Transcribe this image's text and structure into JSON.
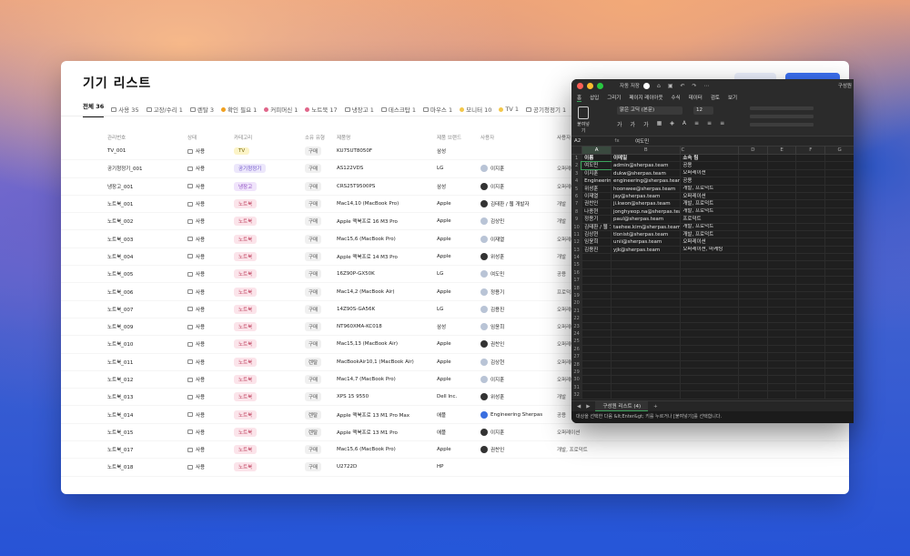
{
  "main": {
    "title": "기기 리스트",
    "tabs": [
      {
        "label": "전체 36",
        "color": ""
      },
      {
        "label": "사용 35",
        "color": ""
      },
      {
        "label": "고장/수리 1",
        "color": ""
      },
      {
        "label": "렌탈 3",
        "color": ""
      },
      {
        "label": "확인 필요 1",
        "color": "#f0a020"
      },
      {
        "label": "커피머신 1",
        "color": "#e0668a"
      },
      {
        "label": "노트북 17",
        "color": "#e0668a"
      },
      {
        "label": "냉장고 1",
        "color": ""
      },
      {
        "label": "데스크탑 1",
        "color": ""
      },
      {
        "label": "마우스 1",
        "color": ""
      },
      {
        "label": "모니터 10",
        "color": "#f3c74a"
      },
      {
        "label": "TV 1",
        "color": "#f3c74a"
      },
      {
        "label": "공기청정기 1",
        "color": ""
      },
      {
        "label": "키보드",
        "color": ""
      }
    ],
    "columns": [
      "관리번호",
      "상태",
      "카테고리",
      "소유 유형",
      "제품명",
      "제품 브랜드",
      "사용자",
      "사용자 소속"
    ],
    "rows": [
      {
        "id": "TV_001",
        "status": "사용",
        "category": "TV",
        "cat_style": "tv",
        "buy": "구매",
        "model": "KU75UT8050F",
        "brand": "삼성",
        "user": "",
        "avatar": "",
        "dept": ""
      },
      {
        "id": "공기청정기_001",
        "status": "사용",
        "category": "공기청정기",
        "cat_style": "ap",
        "buy": "구매",
        "model": "AS122VDS",
        "brand": "LG",
        "user": "이지훈",
        "avatar": "light",
        "dept": "오퍼레이션"
      },
      {
        "id": "냉장고_001",
        "status": "사용",
        "category": "냉장고",
        "cat_style": "fr",
        "buy": "구매",
        "model": "CRS25T9500PS",
        "brand": "삼성",
        "user": "이지훈",
        "avatar": "dark",
        "dept": "오퍼레이션"
      },
      {
        "id": "노트북_001",
        "status": "사용",
        "category": "노트북",
        "cat_style": "nb",
        "buy": "구매",
        "model": "Mac14,10 (MacBook Pro)",
        "brand": "Apple",
        "user": "김태환 / 웹 개발자",
        "avatar": "dark",
        "dept": "개발"
      },
      {
        "id": "노트북_002",
        "status": "사용",
        "category": "노트북",
        "cat_style": "nb",
        "buy": "구매",
        "model": "Apple 맥북프로 16 M3 Pro",
        "brand": "Apple",
        "user": "김상민",
        "avatar": "light",
        "dept": "개발"
      },
      {
        "id": "노트북_003",
        "status": "사용",
        "category": "노트북",
        "cat_style": "nb",
        "buy": "구매",
        "model": "Mac15,6 (MacBook Pro)",
        "brand": "Apple",
        "user": "이재열",
        "avatar": "light",
        "dept": "오퍼레이션"
      },
      {
        "id": "노트북_004",
        "status": "사용",
        "category": "노트북",
        "cat_style": "nb",
        "buy": "구매",
        "model": "Apple 맥북프로 14 M3 Pro",
        "brand": "Apple",
        "user": "위성훈",
        "avatar": "dark",
        "dept": "개발"
      },
      {
        "id": "노트북_005",
        "status": "사용",
        "category": "노트북",
        "cat_style": "nb",
        "buy": "구매",
        "model": "16Z90P-GX50K",
        "brand": "LG",
        "user": "여도민",
        "avatar": "light",
        "dept": "공용"
      },
      {
        "id": "노트북_006",
        "status": "사용",
        "category": "노트북",
        "cat_style": "nb",
        "buy": "구매",
        "model": "Mac14,2 (MacBook Air)",
        "brand": "Apple",
        "user": "정용기",
        "avatar": "light",
        "dept": "프로덕트"
      },
      {
        "id": "노트북_007",
        "status": "사용",
        "category": "노트북",
        "cat_style": "nb",
        "buy": "구매",
        "model": "14Z90S-GA56K",
        "brand": "LG",
        "user": "김용진",
        "avatar": "light",
        "dept": "오퍼레이션"
      },
      {
        "id": "노트북_009",
        "status": "사용",
        "category": "노트북",
        "cat_style": "nb",
        "buy": "구매",
        "model": "NT960XMA-KC018",
        "brand": "삼성",
        "user": "임윤희",
        "avatar": "light",
        "dept": "오퍼레이션"
      },
      {
        "id": "노트북_010",
        "status": "사용",
        "category": "노트북",
        "cat_style": "nb",
        "buy": "구매",
        "model": "Mac15,13 (MacBook Air)",
        "brand": "Apple",
        "user": "권찬인",
        "avatar": "dark",
        "dept": "오퍼레이션"
      },
      {
        "id": "노트북_011",
        "status": "사용",
        "category": "노트북",
        "cat_style": "nb",
        "buy": "렌탈",
        "model": "MacBookAir10,1 (MacBook Air)",
        "brand": "Apple",
        "user": "김상현",
        "avatar": "light",
        "dept": "오퍼레이션"
      },
      {
        "id": "노트북_012",
        "status": "사용",
        "category": "노트북",
        "cat_style": "nb",
        "buy": "구매",
        "model": "Mac14,7 (MacBook Pro)",
        "brand": "Apple",
        "user": "이지훈",
        "avatar": "light",
        "dept": "오퍼레이션"
      },
      {
        "id": "노트북_013",
        "status": "사용",
        "category": "노트북",
        "cat_style": "nb",
        "buy": "구매",
        "model": "XPS 15 9550",
        "brand": "Dell Inc.",
        "user": "위성훈",
        "avatar": "dark",
        "dept": "개발"
      },
      {
        "id": "노트북_014",
        "status": "사용",
        "category": "노트북",
        "cat_style": "nb",
        "buy": "렌탈",
        "model": "Apple 맥북프로 13 M1 Pro Max",
        "brand": "애플",
        "user": "Engineering Sherpas",
        "avatar": "blue",
        "dept": "공용"
      },
      {
        "id": "노트북_015",
        "status": "사용",
        "category": "노트북",
        "cat_style": "nb",
        "buy": "렌탈",
        "model": "Apple 맥북프로 13 M1 Pro",
        "brand": "애플",
        "user": "이지훈",
        "avatar": "dark",
        "dept": "오퍼레이션"
      },
      {
        "id": "노트북_017",
        "status": "사용",
        "category": "노트북",
        "cat_style": "nb",
        "buy": "구매",
        "model": "Mac15,6 (MacBook Pro)",
        "brand": "Apple",
        "user": "권찬인",
        "avatar": "dark",
        "dept": "개발, 프로덕트"
      },
      {
        "id": "노트북_018",
        "status": "사용",
        "category": "노트북",
        "cat_style": "nb",
        "buy": "구매",
        "model": "U2722D",
        "brand": "HP",
        "user": "",
        "avatar": "",
        "dept": ""
      }
    ]
  },
  "excel": {
    "autosave": "자동 저장",
    "filename": "구성원",
    "menu": [
      "홈",
      "삽입",
      "그리기",
      "페이지 레이아웃",
      "수식",
      "데이터",
      "검토",
      "보기"
    ],
    "paste_label": "붙여넣기",
    "font_name": "맑은 고딕 (본문)",
    "font_size": "12",
    "namebox": "A2",
    "fx": "fx",
    "formula_value": "여도민",
    "columns": [
      "A",
      "B",
      "C",
      "D",
      "E",
      "F",
      "G"
    ],
    "rows": [
      [
        "이름",
        "이메일",
        "소속 팀"
      ],
      [
        "여도민",
        "admin@sherpas.team",
        "공용"
      ],
      [
        "이지훈",
        "dukw@sherpas.team",
        "오퍼레이션"
      ],
      [
        "Engineering S",
        "engineering@sherpas.team",
        "공용"
      ],
      [
        "위성훈",
        "hoonwee@sherpas.team",
        "개발, 프로덕트"
      ],
      [
        "이재열",
        "jay@sherpas.team",
        "오퍼레이션"
      ],
      [
        "권찬인",
        "ji.kwon@sherpas.team",
        "개발, 프로덕트"
      ],
      [
        "나종현",
        "jonghyeop.na@sherpas.team",
        "개발, 프로덕트"
      ],
      [
        "정용기",
        "paul@sherpas.team",
        "프로덕트"
      ],
      [
        "김태환 / 웹 7",
        "taehee.kim@sherpas.team",
        "개발, 프로덕트"
      ],
      [
        "김상현",
        "tlonist@sherpas.team",
        "개발, 프로덕트"
      ],
      [
        "임윤희",
        "unii@sherpas.team",
        "오퍼레이션"
      ],
      [
        "김용진",
        "yjk@sherpas.team",
        "오퍼레이션, 마케팅"
      ]
    ],
    "total_rows": 32,
    "sheet_tab": "구성원 리스트 (4)",
    "status": "대상을 선택한 다음 &lt;Enter&gt; 키를 누르거나 [붙여넣기]를 선택합니다."
  }
}
